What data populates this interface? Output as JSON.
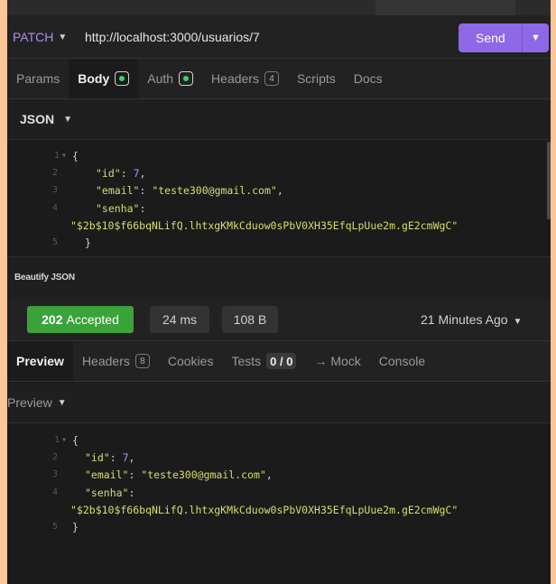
{
  "request": {
    "method": "PATCH",
    "url": "http://localhost:3000/usuarios/7",
    "send_label": "Send",
    "tabs": [
      {
        "label": "Params"
      },
      {
        "label": "Body"
      },
      {
        "label": "Auth"
      },
      {
        "label": "Headers",
        "count": "4"
      },
      {
        "label": "Scripts"
      },
      {
        "label": "Docs"
      }
    ],
    "body_type": "JSON",
    "body_lines": [
      {
        "n": "1",
        "text": "{"
      },
      {
        "n": "2",
        "key": "\"id\"",
        "val": "7",
        "kind": "num"
      },
      {
        "n": "3",
        "key": "\"email\"",
        "val": "\"teste300@gmail.com\"",
        "kind": "str"
      },
      {
        "n": "4",
        "key": "\"senha\"",
        "val": "\"$2b$10$f66bqNLifQ.lhtxgKMkCduow0sPbV0XH35EfqLpUue2m.gE2cmWgC\""
      },
      {
        "n": "5",
        "text": "}"
      }
    ],
    "beautify_label": "Beautify JSON"
  },
  "response": {
    "status_code": "202",
    "status_text": "Accepted",
    "time": "24 ms",
    "size": "108 B",
    "ago": "21 Minutes Ago",
    "tabs": [
      {
        "label": "Preview"
      },
      {
        "label": "Headers",
        "count": "8"
      },
      {
        "label": "Cookies"
      },
      {
        "label": "Tests",
        "count": "0 / 0"
      },
      {
        "label": "→ Mock"
      },
      {
        "label": "Console"
      }
    ],
    "preview_label": "Preview",
    "body_lines": [
      {
        "n": "1",
        "text": "{"
      },
      {
        "n": "2",
        "key": "\"id\"",
        "val": "7"
      },
      {
        "n": "3",
        "key": "\"email\"",
        "val": "\"teste300@gmail.com\""
      },
      {
        "n": "4",
        "key": "\"senha\"",
        "val": "\"$2b$10$f66bqNLifQ.lhtxgKMkCduow0sPbV0XH35EfqLpUue2m.gE2cmWgC\""
      },
      {
        "n": "5",
        "text": "}"
      }
    ]
  },
  "colors": {
    "accent": "#8e68e6",
    "method": "#b58cf0",
    "success": "#3aa33a",
    "json_string": "#d8dd6b",
    "json_number": "#b58cf0",
    "background": "#fbc59a"
  }
}
